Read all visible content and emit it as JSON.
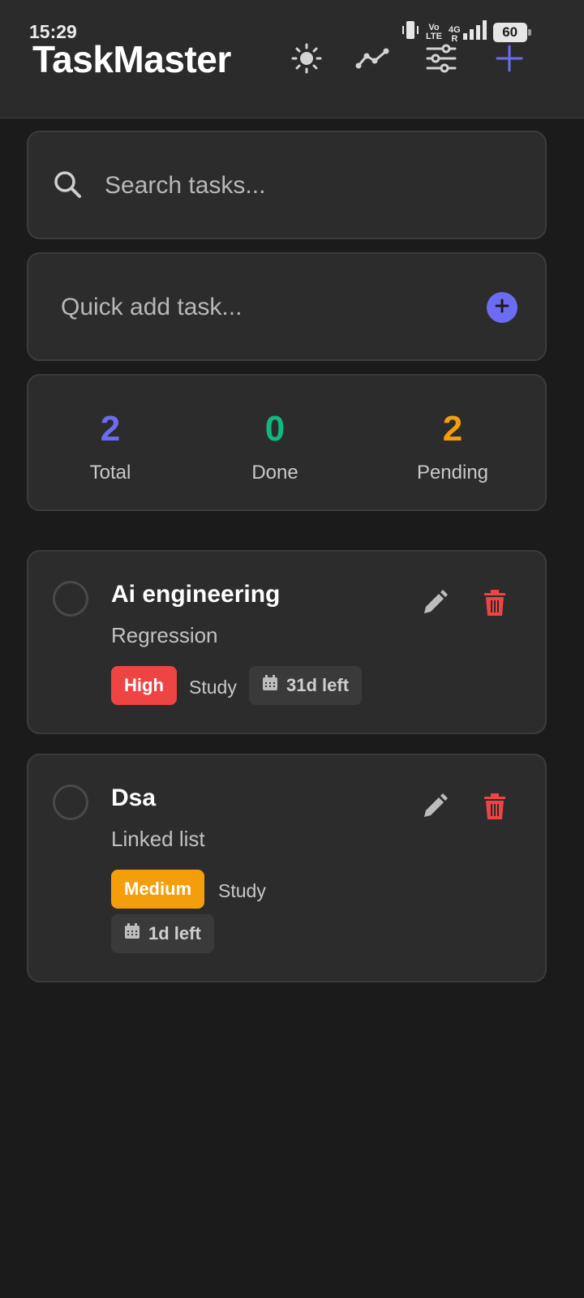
{
  "status_bar": {
    "time": "15:29",
    "network_top": "Vo",
    "network_bottom": "LTE",
    "signal_label": "4G",
    "roaming": "R",
    "battery": "60"
  },
  "app": {
    "title": "TaskMaster"
  },
  "toolbar": {
    "icons": [
      "sun-icon",
      "trend-chart-icon",
      "sliders-icon",
      "plus-icon"
    ],
    "accent_color": "#6c6cf2"
  },
  "search": {
    "placeholder": "Search tasks...",
    "value": ""
  },
  "quick_add": {
    "placeholder": "Quick add task...",
    "value": ""
  },
  "stats": {
    "total_value": "2",
    "total_label": "Total",
    "done_value": "0",
    "done_label": "Done",
    "pending_value": "2",
    "pending_label": "Pending",
    "colors": {
      "total": "#6c6cf2",
      "done": "#10b981",
      "pending": "#f59e0b"
    }
  },
  "tasks": [
    {
      "title": "Ai engineering",
      "description": "Regression",
      "priority": "High",
      "priority_color": "#ef4444",
      "category": "Study",
      "due": "31d left",
      "completed": false
    },
    {
      "title": "Dsa",
      "description": "Linked list",
      "priority": "Medium",
      "priority_color": "#f59e0b",
      "category": "Study",
      "due": "1d left",
      "completed": false
    }
  ]
}
